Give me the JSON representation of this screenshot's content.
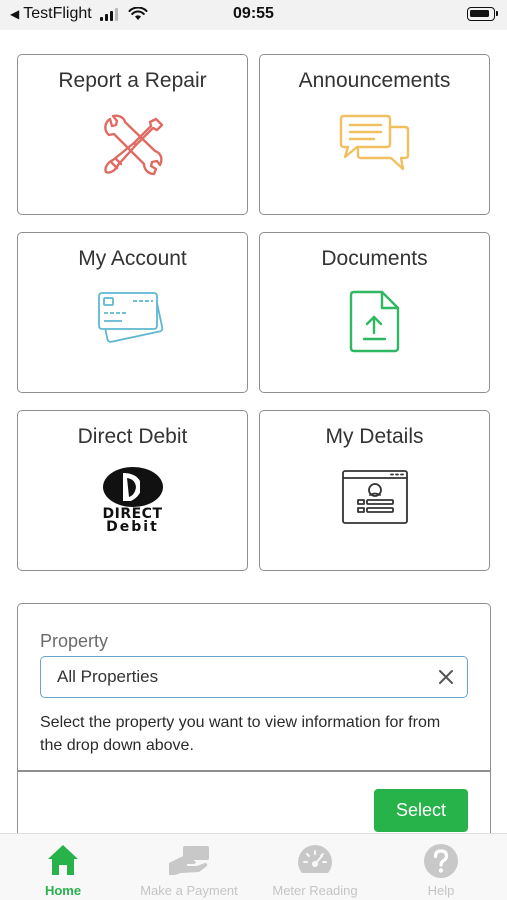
{
  "status_bar": {
    "back_app": "TestFlight",
    "time": "09:55"
  },
  "tiles": [
    {
      "label": "Report a Repair",
      "icon": "tools-icon",
      "color": "#e06b63"
    },
    {
      "label": "Announcements",
      "icon": "chat-bubbles-icon",
      "color": "#f0c060"
    },
    {
      "label": "My Account",
      "icon": "credit-cards-icon",
      "color": "#5fb7cf"
    },
    {
      "label": "Documents",
      "icon": "document-upload-icon",
      "color": "#2fb862"
    },
    {
      "label": "Direct Debit",
      "icon": "direct-debit-logo",
      "logo_line1": "DIRECT",
      "logo_line2": "Debit"
    },
    {
      "label": "My Details",
      "icon": "profile-window-icon",
      "color": "#333333"
    }
  ],
  "property": {
    "label": "Property",
    "value": "All Properties",
    "help_text": "Select the property you want to view information for from the drop down above.",
    "select_label": "Select"
  },
  "nav": {
    "items": [
      {
        "label": "Home",
        "icon": "home-icon",
        "active": true
      },
      {
        "label": "Make a Payment",
        "icon": "payment-hand-icon",
        "active": false
      },
      {
        "label": "Meter Reading",
        "icon": "gauge-icon",
        "active": false
      },
      {
        "label": "Help",
        "icon": "help-icon",
        "active": false
      }
    ]
  },
  "colors": {
    "accent_green": "#27b24a",
    "input_border": "#6aa3cc",
    "nav_inactive": "#c4c4c4"
  }
}
